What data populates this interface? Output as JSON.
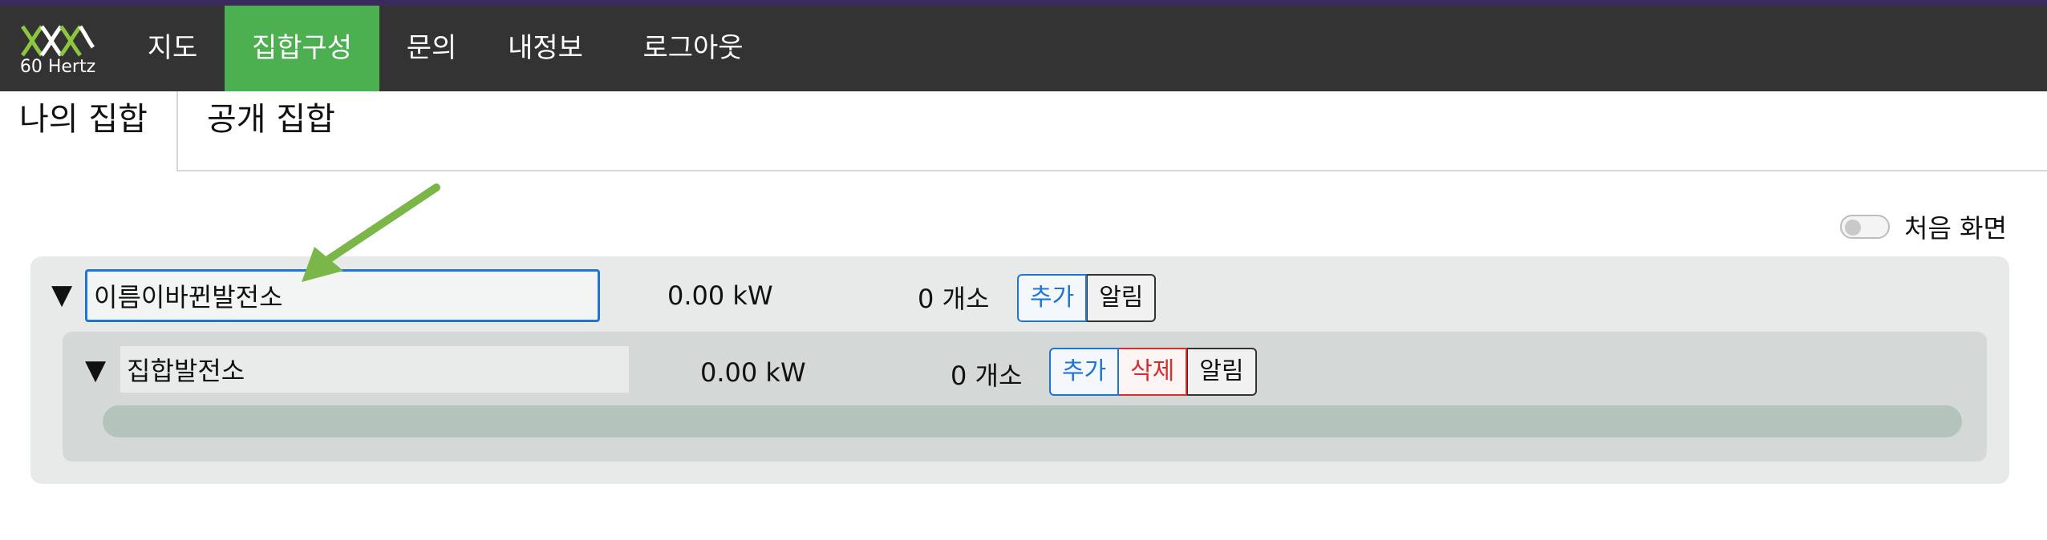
{
  "nav": {
    "logo_text": "60 Hertz",
    "items": [
      {
        "label": "지도",
        "active": false
      },
      {
        "label": "집합구성",
        "active": true
      },
      {
        "label": "문의",
        "active": false
      },
      {
        "label": "내정보",
        "active": false
      },
      {
        "label": "로그아웃",
        "active": false
      }
    ]
  },
  "tabs": {
    "mine": "나의 집합",
    "public": "공개 집합"
  },
  "toggle": {
    "label": "처음 화면",
    "on": false
  },
  "group": {
    "expander": "▼",
    "name_value": "이름이바뀐발전소",
    "power": "0.00 kW",
    "count": "0 개소",
    "add_label": "추가",
    "alarm_label": "알림",
    "child": {
      "expander": "▼",
      "name_value": "집합발전소",
      "power": "0.00 kW",
      "count": "0 개소",
      "add_label": "추가",
      "delete_label": "삭제",
      "alarm_label": "알림"
    }
  },
  "colors": {
    "nav_bg": "#333333",
    "nav_active": "#4caf50",
    "accent_blue": "#1f76d2",
    "danger_red": "#d32f2f",
    "annotation_arrow": "#7ab648"
  },
  "icons": {
    "logo": "dna-helix-logo",
    "expander": "triangle-down-icon",
    "annotation": "green-arrow-icon"
  }
}
